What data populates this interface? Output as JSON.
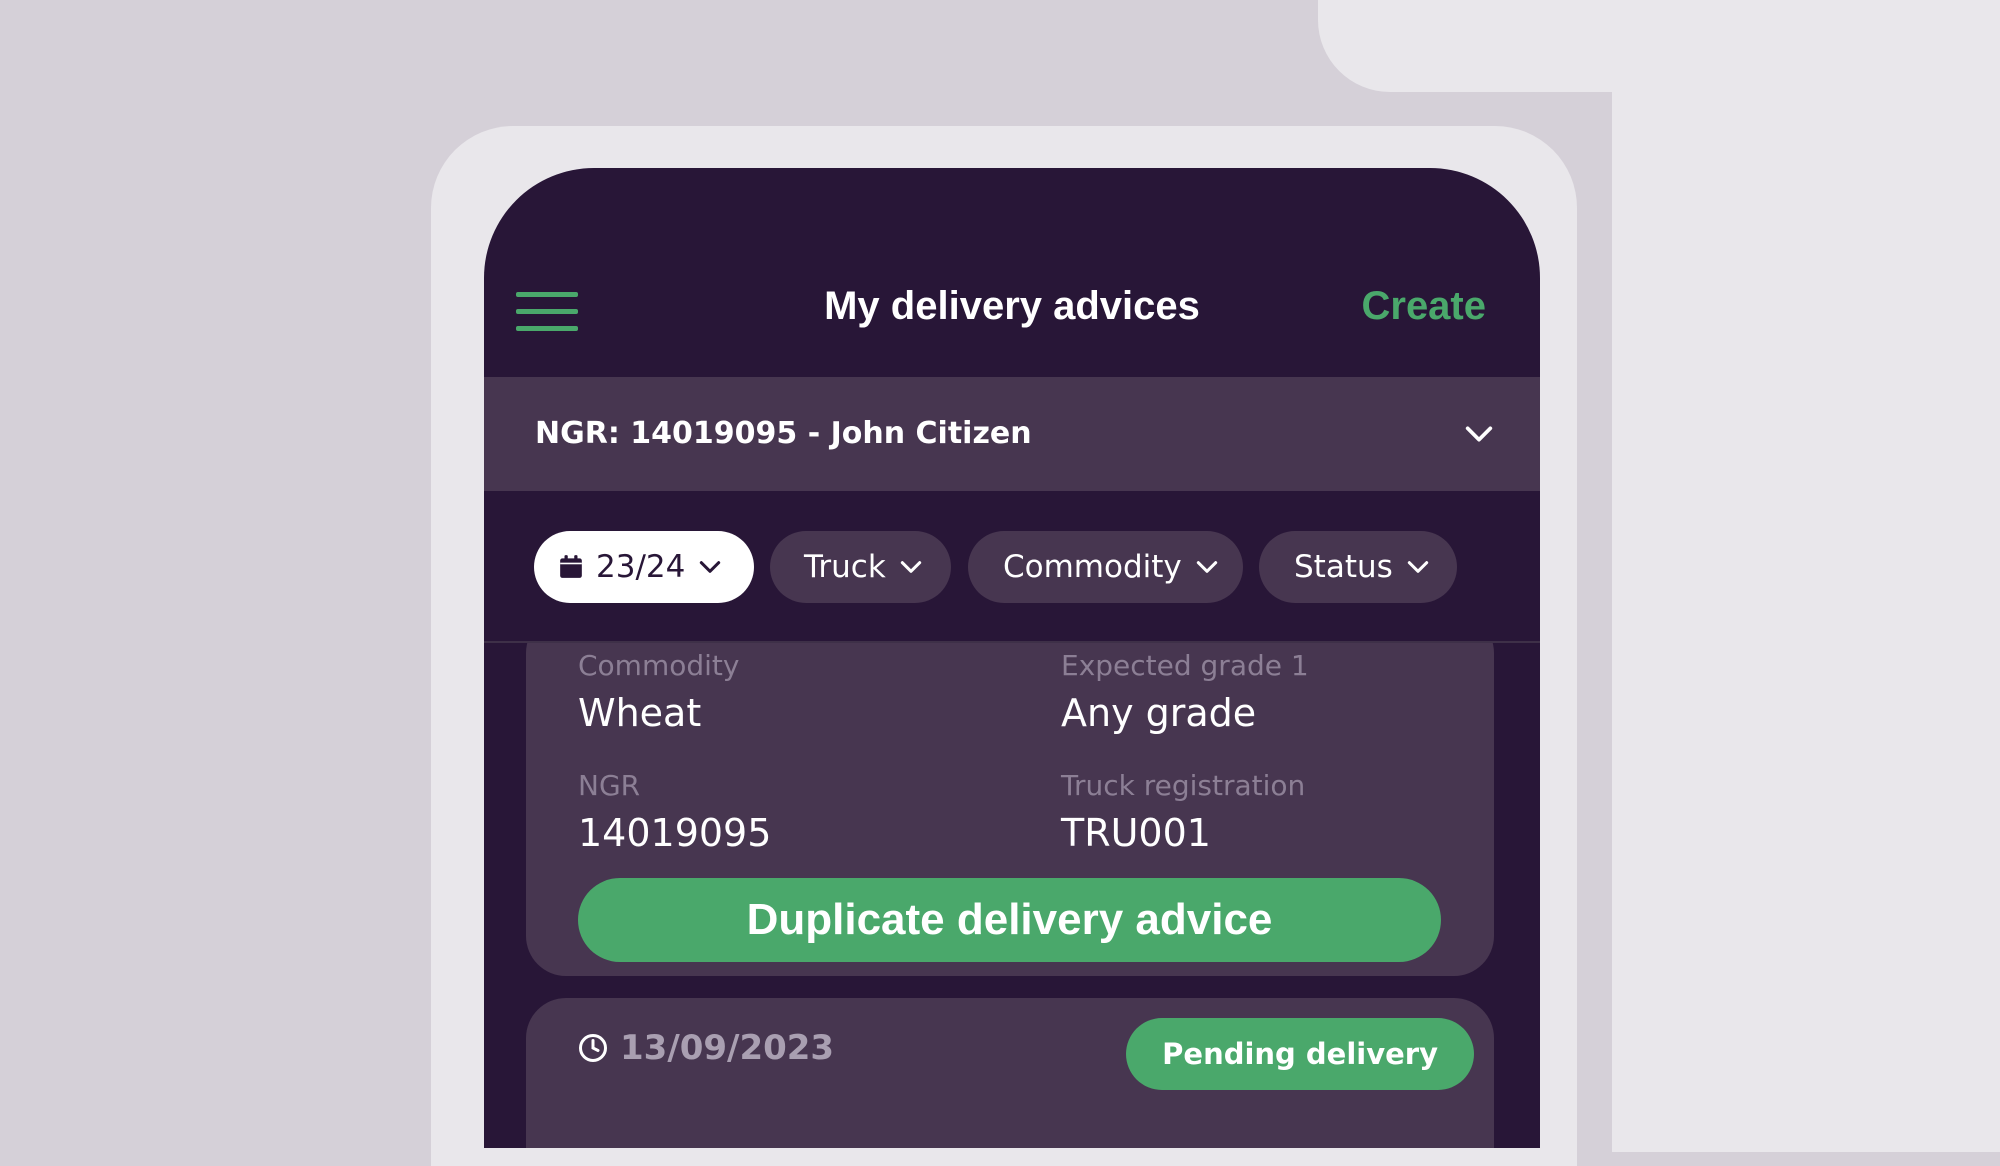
{
  "header": {
    "title": "My delivery advices",
    "create_label": "Create"
  },
  "ngr_selector": {
    "label": "NGR: 14019095 - John Citizen"
  },
  "filters": {
    "season": "23/24",
    "truck": "Truck",
    "commodity": "Commodity",
    "status": "Status"
  },
  "delivery_card": {
    "commodity_label": "Commodity",
    "commodity_value": "Wheat",
    "grade_label": "Expected grade 1",
    "grade_value": "Any grade",
    "ngr_label": "NGR",
    "ngr_value": "14019095",
    "truck_label": "Truck registration",
    "truck_value": "TRU001",
    "duplicate_label": "Duplicate delivery advice"
  },
  "next_card": {
    "date": "13/09/2023",
    "status": "Pending delivery"
  },
  "colors": {
    "accent_green": "#4aa86b",
    "phone_bg": "#281637",
    "card_bg": "#473650"
  }
}
